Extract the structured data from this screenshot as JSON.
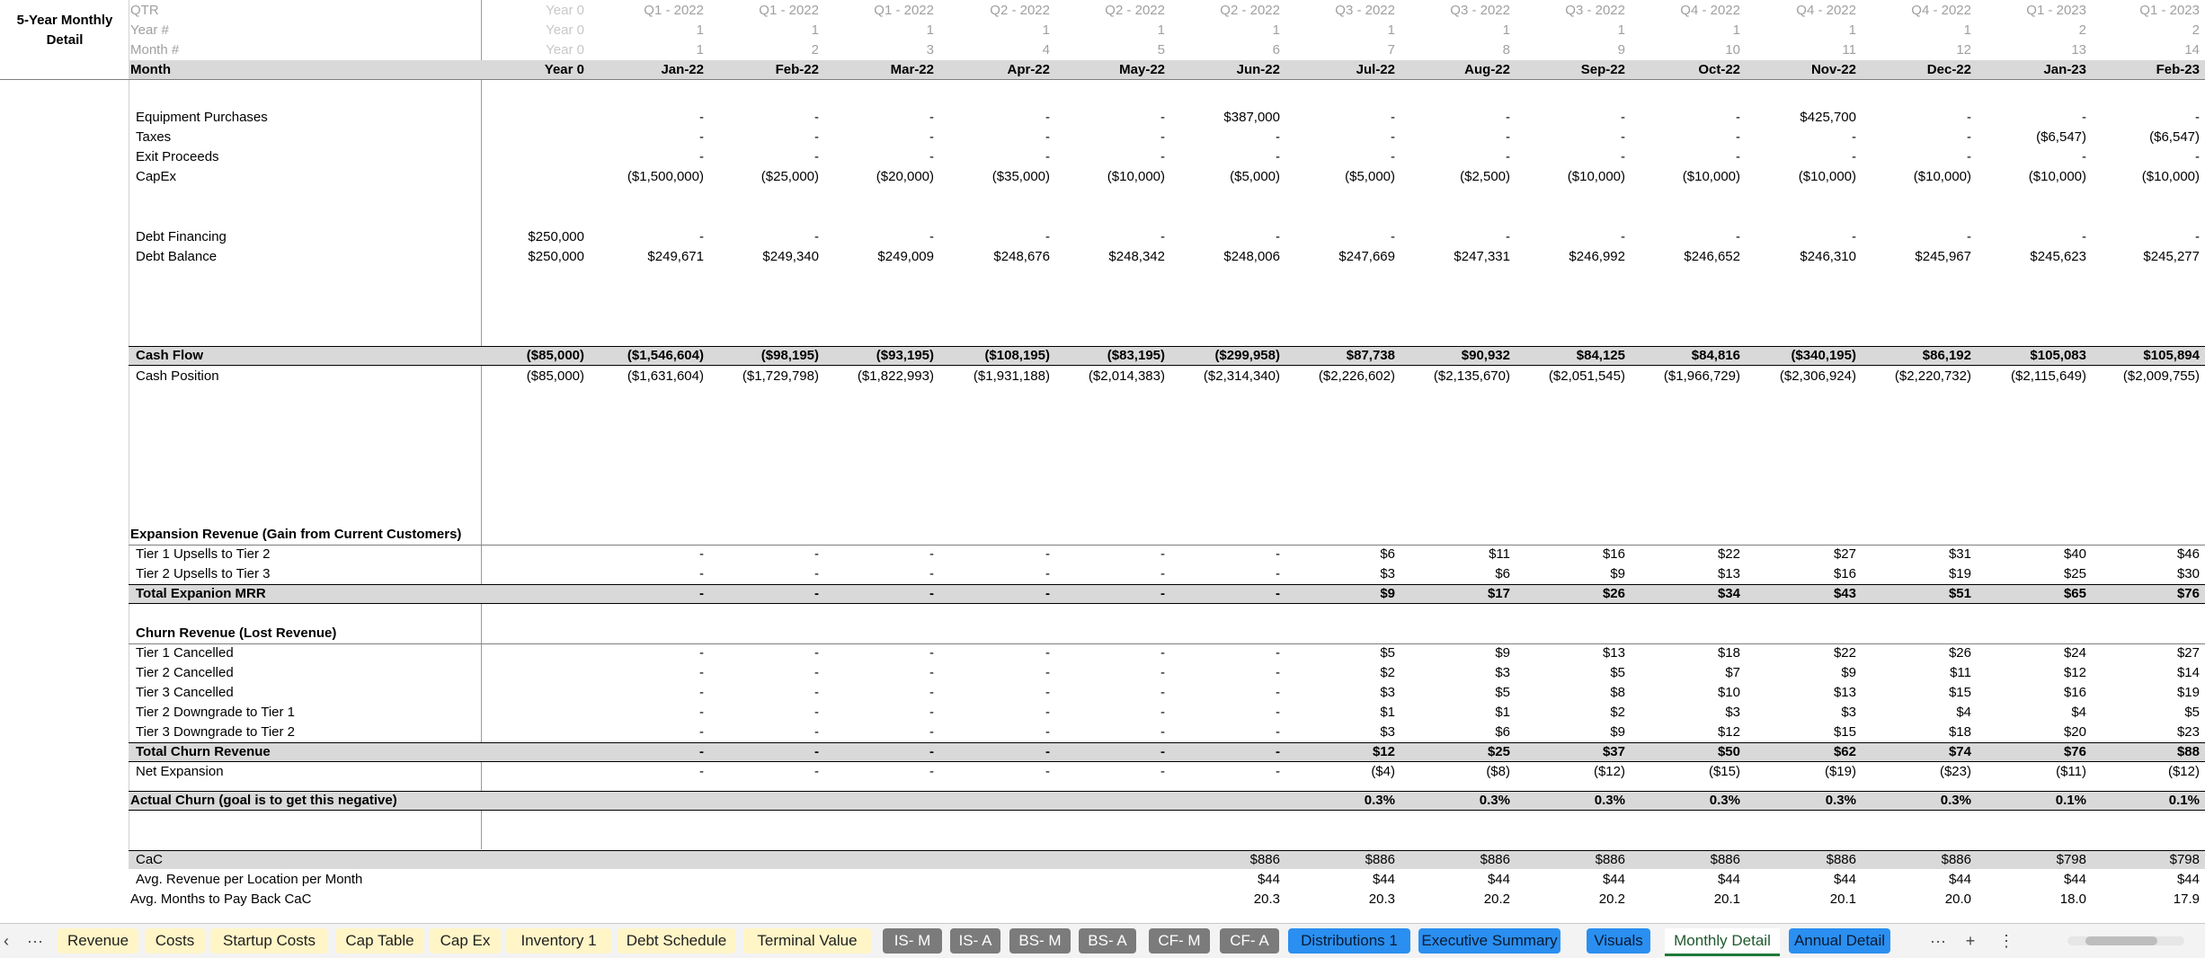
{
  "sheet_title": "5-Year Monthly Detail",
  "header": {
    "qtr_label": "QTR",
    "year_label": "Year #",
    "month_num_label": "Month #",
    "month_label": "Month",
    "columns": [
      {
        "qtr": "Year 0",
        "year": "Year 0",
        "mnum": "Year 0",
        "month": "Year 0"
      },
      {
        "qtr": "Q1 - 2022",
        "year": "1",
        "mnum": "1",
        "month": "Jan-22"
      },
      {
        "qtr": "Q1 - 2022",
        "year": "1",
        "mnum": "2",
        "month": "Feb-22"
      },
      {
        "qtr": "Q1 - 2022",
        "year": "1",
        "mnum": "3",
        "month": "Mar-22"
      },
      {
        "qtr": "Q2 - 2022",
        "year": "1",
        "mnum": "4",
        "month": "Apr-22"
      },
      {
        "qtr": "Q2 - 2022",
        "year": "1",
        "mnum": "5",
        "month": "May-22"
      },
      {
        "qtr": "Q2 - 2022",
        "year": "1",
        "mnum": "6",
        "month": "Jun-22"
      },
      {
        "qtr": "Q3 - 2022",
        "year": "1",
        "mnum": "7",
        "month": "Jul-22"
      },
      {
        "qtr": "Q3 - 2022",
        "year": "1",
        "mnum": "8",
        "month": "Aug-22"
      },
      {
        "qtr": "Q3 - 2022",
        "year": "1",
        "mnum": "9",
        "month": "Sep-22"
      },
      {
        "qtr": "Q4 - 2022",
        "year": "1",
        "mnum": "10",
        "month": "Oct-22"
      },
      {
        "qtr": "Q4 - 2022",
        "year": "1",
        "mnum": "11",
        "month": "Nov-22"
      },
      {
        "qtr": "Q4 - 2022",
        "year": "1",
        "mnum": "12",
        "month": "Dec-22"
      },
      {
        "qtr": "Q1 - 2023",
        "year": "2",
        "mnum": "13",
        "month": "Jan-23"
      },
      {
        "qtr": "Q1 - 2023",
        "year": "2",
        "mnum": "14",
        "month": "Feb-23"
      }
    ]
  },
  "rows": {
    "equipment_purchases": {
      "label": "Equipment Purchases",
      "values": [
        "",
        "-",
        "-",
        "-",
        "-",
        "-",
        "$387,000",
        "-",
        "-",
        "-",
        "-",
        "$425,700",
        "-",
        "-",
        "-"
      ]
    },
    "taxes": {
      "label": "Taxes",
      "values": [
        "",
        "-",
        "-",
        "-",
        "-",
        "-",
        "-",
        "-",
        "-",
        "-",
        "-",
        "-",
        "-",
        "($6,547)",
        "($6,547)"
      ]
    },
    "exit_proceeds": {
      "label": "Exit Proceeds",
      "values": [
        "",
        "-",
        "-",
        "-",
        "-",
        "-",
        "-",
        "-",
        "-",
        "-",
        "-",
        "-",
        "-",
        "-",
        "-"
      ]
    },
    "capex": {
      "label": "CapEx",
      "values": [
        "",
        "($1,500,000)",
        "($25,000)",
        "($20,000)",
        "($35,000)",
        "($10,000)",
        "($5,000)",
        "($5,000)",
        "($2,500)",
        "($10,000)",
        "($10,000)",
        "($10,000)",
        "($10,000)",
        "($10,000)",
        "($10,000)"
      ]
    },
    "debt_financing": {
      "label": "Debt Financing",
      "values": [
        "$250,000",
        "-",
        "-",
        "-",
        "-",
        "-",
        "-",
        "-",
        "-",
        "-",
        "-",
        "-",
        "-",
        "-",
        "-"
      ]
    },
    "debt_balance": {
      "label": "Debt Balance",
      "values": [
        "$250,000",
        "$249,671",
        "$249,340",
        "$249,009",
        "$248,676",
        "$248,342",
        "$248,006",
        "$247,669",
        "$247,331",
        "$246,992",
        "$246,652",
        "$246,310",
        "$245,967",
        "$245,623",
        "$245,277"
      ]
    },
    "cash_flow": {
      "label": "Cash Flow",
      "values": [
        "($85,000)",
        "($1,546,604)",
        "($98,195)",
        "($93,195)",
        "($108,195)",
        "($83,195)",
        "($299,958)",
        "$87,738",
        "$90,932",
        "$84,125",
        "$84,816",
        "($340,195)",
        "$86,192",
        "$105,083",
        "$105,894"
      ]
    },
    "cash_position": {
      "label": "Cash Position",
      "values": [
        "($85,000)",
        "($1,631,604)",
        "($1,729,798)",
        "($1,822,993)",
        "($1,931,188)",
        "($2,014,383)",
        "($2,314,340)",
        "($2,226,602)",
        "($2,135,670)",
        "($2,051,545)",
        "($1,966,729)",
        "($2,306,924)",
        "($2,220,732)",
        "($2,115,649)",
        "($2,009,755)"
      ]
    },
    "expansion_header": {
      "label": "Expansion Revenue (Gain from Current Customers)"
    },
    "tier1_upsells": {
      "label": "Tier 1 Upsells to Tier 2",
      "values": [
        "",
        "-",
        "-",
        "-",
        "-",
        "-",
        "-",
        "$6",
        "$11",
        "$16",
        "$22",
        "$27",
        "$31",
        "$40",
        "$46"
      ]
    },
    "tier2_upsells": {
      "label": "Tier 2 Upsells to Tier 3",
      "values": [
        "",
        "-",
        "-",
        "-",
        "-",
        "-",
        "-",
        "$3",
        "$6",
        "$9",
        "$13",
        "$16",
        "$19",
        "$25",
        "$30"
      ]
    },
    "total_expansion": {
      "label": "Total Expanion MRR",
      "values": [
        "",
        "-",
        "-",
        "-",
        "-",
        "-",
        "-",
        "$9",
        "$17",
        "$26",
        "$34",
        "$43",
        "$51",
        "$65",
        "$76"
      ]
    },
    "churn_header": {
      "label": "Churn Revenue (Lost Revenue)"
    },
    "tier1_cancelled": {
      "label": "Tier 1 Cancelled",
      "values": [
        "",
        "-",
        "-",
        "-",
        "-",
        "-",
        "-",
        "$5",
        "$9",
        "$13",
        "$18",
        "$22",
        "$26",
        "$24",
        "$27"
      ]
    },
    "tier2_cancelled": {
      "label": "Tier 2 Cancelled",
      "values": [
        "",
        "-",
        "-",
        "-",
        "-",
        "-",
        "-",
        "$2",
        "$3",
        "$5",
        "$7",
        "$9",
        "$11",
        "$12",
        "$14"
      ]
    },
    "tier3_cancelled": {
      "label": "Tier 3 Cancelled",
      "values": [
        "",
        "-",
        "-",
        "-",
        "-",
        "-",
        "-",
        "$3",
        "$5",
        "$8",
        "$10",
        "$13",
        "$15",
        "$16",
        "$19"
      ]
    },
    "tier2_downgrade": {
      "label": "Tier 2 Downgrade to Tier 1",
      "values": [
        "",
        "-",
        "-",
        "-",
        "-",
        "-",
        "-",
        "$1",
        "$1",
        "$2",
        "$3",
        "$3",
        "$4",
        "$4",
        "$5"
      ]
    },
    "tier3_downgrade": {
      "label": "Tier 3 Downgrade to Tier 2",
      "values": [
        "",
        "-",
        "-",
        "-",
        "-",
        "-",
        "-",
        "$3",
        "$6",
        "$9",
        "$12",
        "$15",
        "$18",
        "$20",
        "$23"
      ]
    },
    "total_churn": {
      "label": "Total Churn Revenue",
      "values": [
        "",
        "-",
        "-",
        "-",
        "-",
        "-",
        "-",
        "$12",
        "$25",
        "$37",
        "$50",
        "$62",
        "$74",
        "$76",
        "$88"
      ]
    },
    "net_expansion": {
      "label": "Net Expansion",
      "values": [
        "",
        "-",
        "-",
        "-",
        "-",
        "-",
        "-",
        "($4)",
        "($8)",
        "($12)",
        "($15)",
        "($19)",
        "($23)",
        "($11)",
        "($12)"
      ]
    },
    "actual_churn": {
      "label": "Actual Churn (goal is to get this negative)",
      "values": [
        "",
        "",
        "",
        "",
        "",
        "",
        "",
        "0.3%",
        "0.3%",
        "0.3%",
        "0.3%",
        "0.3%",
        "0.3%",
        "0.1%",
        "0.1%"
      ]
    },
    "cac": {
      "label": "CaC",
      "values": [
        "",
        "",
        "",
        "",
        "",
        "",
        "$886",
        "$886",
        "$886",
        "$886",
        "$886",
        "$886",
        "$886",
        "$798",
        "$798"
      ]
    },
    "avg_revenue": {
      "label": "Avg. Revenue per Location per Month",
      "values": [
        "",
        "",
        "",
        "",
        "",
        "",
        "$44",
        "$44",
        "$44",
        "$44",
        "$44",
        "$44",
        "$44",
        "$44",
        "$44"
      ]
    },
    "avg_payback": {
      "label": "Avg. Months to Pay Back CaC",
      "values": [
        "",
        "",
        "",
        "",
        "",
        "",
        "20.3",
        "20.3",
        "20.2",
        "20.2",
        "20.1",
        "20.1",
        "20.0",
        "18.0",
        "17.9"
      ]
    }
  },
  "tabs": {
    "prev_glyph": "‹",
    "more_left": "···",
    "items": [
      {
        "label": "Revenue",
        "style": "yellow"
      },
      {
        "label": "Costs",
        "style": "yellow"
      },
      {
        "label": "Startup Costs",
        "style": "yellow"
      },
      {
        "label": "Cap Table",
        "style": "yellow"
      },
      {
        "label": "Cap Ex",
        "style": "yellow"
      },
      {
        "label": "Inventory 1",
        "style": "yellow"
      },
      {
        "label": "Debt Schedule",
        "style": "yellow"
      },
      {
        "label": "Terminal Value",
        "style": "yellow"
      },
      {
        "label": "IS- M",
        "style": "gray"
      },
      {
        "label": "IS- A",
        "style": "gray"
      },
      {
        "label": "BS- M",
        "style": "gray"
      },
      {
        "label": "BS- A",
        "style": "gray"
      },
      {
        "label": "CF- M",
        "style": "gray"
      },
      {
        "label": "CF- A",
        "style": "gray"
      },
      {
        "label": "Distributions 1",
        "style": "blue"
      },
      {
        "label": "Executive Summary",
        "style": "blue"
      },
      {
        "label": "Visuals",
        "style": "blue"
      },
      {
        "label": "Monthly Detail",
        "style": "active"
      },
      {
        "label": "Annual Detail",
        "style": "blue"
      }
    ],
    "more_right": "···",
    "add": "+",
    "options": "⋮"
  },
  "colors": {
    "header_band": "#d9d9d9",
    "yellow_tab": "#fff5c7",
    "gray_tab": "#7b7b7b",
    "blue_tab": "#2a8ff0",
    "active_tab_accent": "#1f7a3a"
  }
}
